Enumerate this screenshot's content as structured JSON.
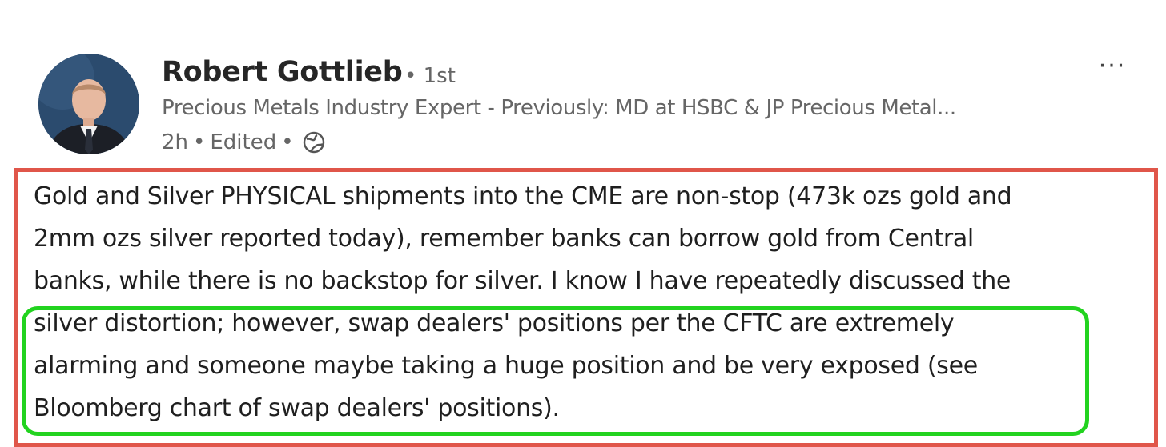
{
  "post": {
    "author": {
      "name": "Robert Gottlieb",
      "degree": "• 1st",
      "headline": "Precious Metals Industry Expert - Previously: MD at HSBC & JP Precious Metal...",
      "time": "2h",
      "separator": "•",
      "edited": "Edited",
      "visibility_icon": "globe-icon"
    },
    "more_menu_label": "···",
    "body_lines": [
      "Gold and Silver PHYSICAL shipments into the CME are non-stop (473k ozs gold and",
      "2mm ozs silver reported today), remember banks can borrow gold from Central",
      "banks, while there is no backstop for silver. I know I have repeatedly discussed the",
      "silver distortion; however, swap dealers' positions per the CFTC are extremely",
      "alarming and someone maybe taking a huge position and be very exposed (see",
      "Bloomberg chart of swap dealers' positions)."
    ]
  },
  "colors": {
    "highlight_red": "#e0564a",
    "highlight_green": "#22d31f",
    "text_primary": "#1f1f1f",
    "text_secondary": "#666666"
  }
}
